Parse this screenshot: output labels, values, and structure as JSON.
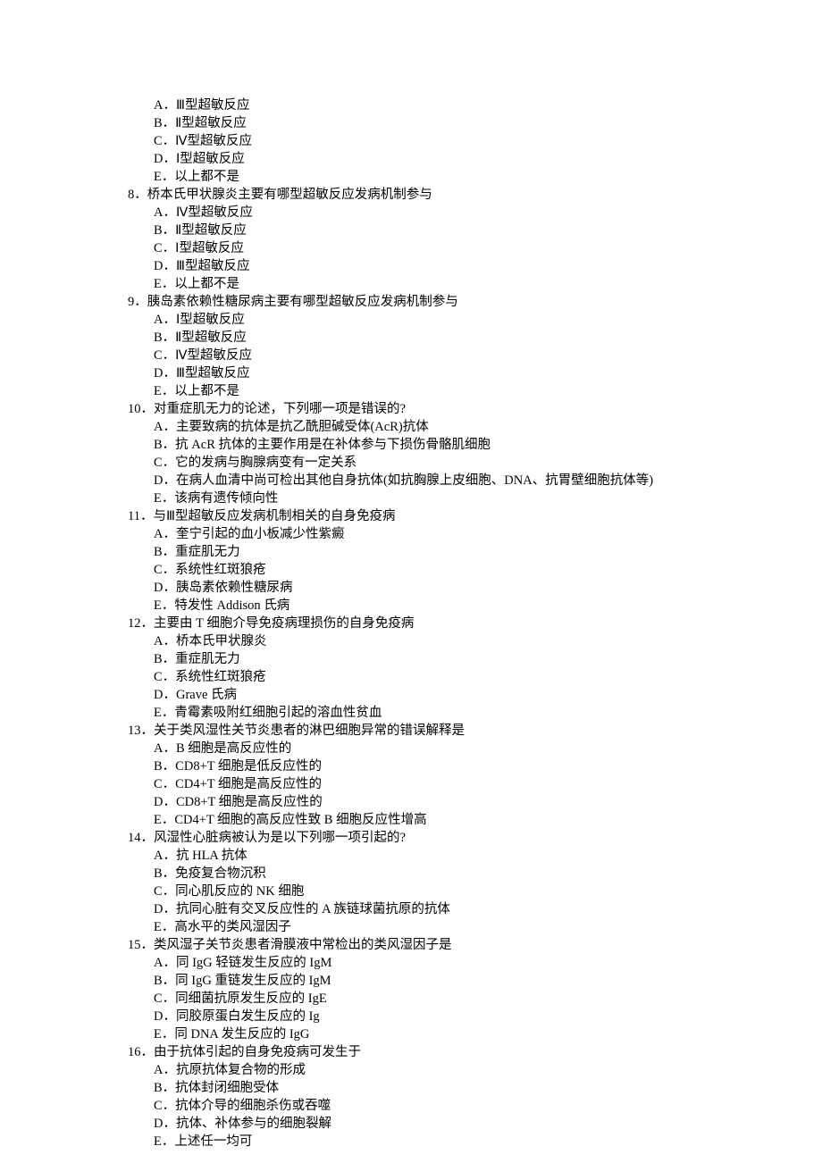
{
  "orphan_q7_options": [
    "A．Ⅲ型超敏反应",
    "B．Ⅱ型超敏反应",
    "C．Ⅳ型超敏反应",
    "D．Ⅰ型超敏反应",
    "E．以上都不是"
  ],
  "questions": [
    {
      "num": "8",
      "stem": "8．桥本氏甲状腺炎主要有哪型超敏反应发病机制参与",
      "options": [
        "A．Ⅳ型超敏反应",
        "B．Ⅱ型超敏反应",
        "C．Ⅰ型超敏反应",
        "D．Ⅲ型超敏反应",
        "E．以上都不是"
      ]
    },
    {
      "num": "9",
      "stem": "9．胰岛素依赖性糖尿病主要有哪型超敏反应发病机制参与",
      "options": [
        "A．Ⅰ型超敏反应",
        "B．Ⅱ型超敏反应",
        "C．Ⅳ型超敏反应",
        "D．Ⅲ型超敏反应",
        "E．以上都不是"
      ]
    },
    {
      "num": "10",
      "stem": "10．对重症肌无力的论述，下列哪一项是错误的?",
      "options": [
        "A．主要致病的抗体是抗乙酰胆碱受体(AcR)抗体",
        "B．抗 AcR 抗体的主要作用是在补体参与下损伤骨骼肌细胞",
        "C．它的发病与胸腺病变有一定关系",
        "D．在病人血清中尚可检出其他自身抗体(如抗胸腺上皮细胞、DNA、抗胃壁细胞抗体等)",
        "E．该病有遗传倾向性"
      ]
    },
    {
      "num": "11",
      "stem": "11．与Ⅲ型超敏反应发病机制相关的自身免疫病",
      "options": [
        "A．奎宁引起的血小板减少性紫癜",
        "B．重症肌无力",
        "C．系统性红斑狼疮",
        "D．胰岛素依赖性糖尿病",
        "E．特发性 Addison 氏病"
      ]
    },
    {
      "num": "12",
      "stem": "12．主要由 T 细胞介导免疫病理损伤的自身免疫病",
      "options": [
        "A．桥本氏甲状腺炎",
        "B．重症肌无力",
        "C．系统性红斑狼疮",
        "D．Grave 氏病",
        "E．青霉素吸附红细胞引起的溶血性贫血"
      ]
    },
    {
      "num": "13",
      "stem": "13．关于类风湿性关节炎患者的淋巴细胞异常的错误解释是",
      "options": [
        "A．B 细胞是高反应性的",
        "B．CD8+T 细胞是低反应性的",
        "C．CD4+T 细胞是高反应性的",
        "D．CD8+T 细胞是高反应性的",
        "E．CD4+T 细胞的高反应性致 B 细胞反应性增高"
      ]
    },
    {
      "num": "14",
      "stem": "14．风湿性心脏病被认为是以下列哪一项引起的?",
      "options": [
        "A．抗 HLA 抗体",
        "B．免疫复合物沉积",
        "C．同心肌反应的 NK 细胞",
        "D．抗同心脏有交叉反应性的 A 族链球菌抗原的抗体",
        "E．高水平的类风湿因子"
      ]
    },
    {
      "num": "15",
      "stem": "15．类风湿子关节炎患者滑膜液中常检出的类风湿因子是",
      "options": [
        "A．同 IgG 轻链发生反应的 IgM",
        "B．同 IgG 重链发生反应的 IgM",
        "C．同细菌抗原发生反应的 IgE",
        "D．同胶原蛋白发生反应的 Ig",
        "E．同 DNA 发生反应的 IgG"
      ]
    },
    {
      "num": "16",
      "stem": "16．由于抗体引起的自身免疫病可发生于",
      "options": [
        "A．抗原抗体复合物的形成",
        "B．抗体封闭细胞受体",
        "C．抗体介导的细胞杀伤或吞噬",
        "D．抗体、补体参与的细胞裂解",
        "E．上述任一均可"
      ]
    }
  ]
}
